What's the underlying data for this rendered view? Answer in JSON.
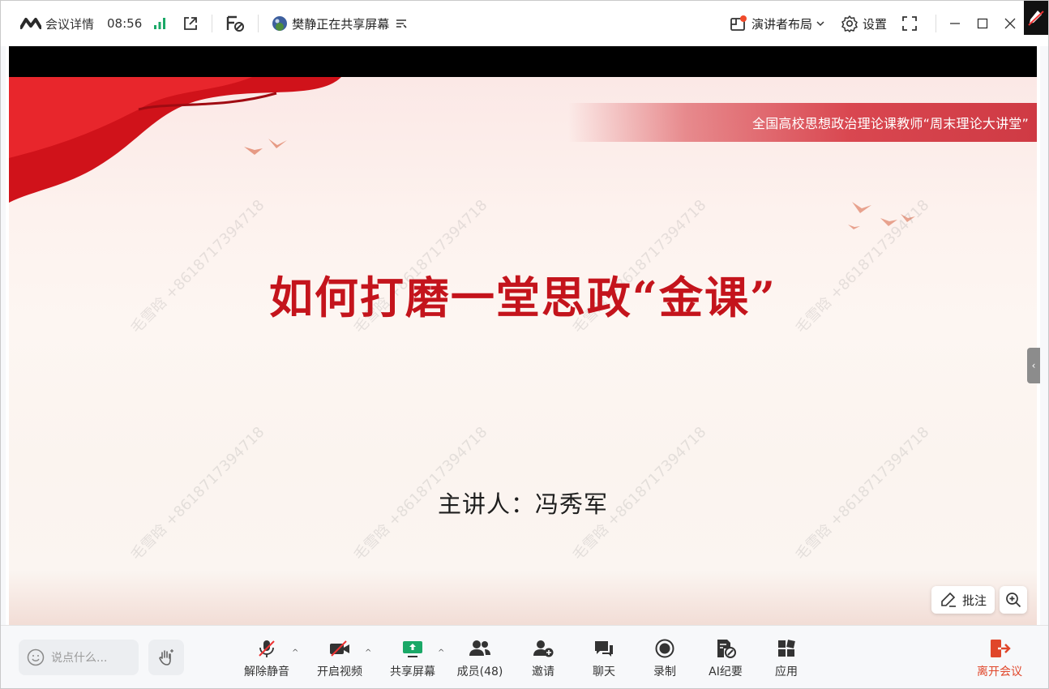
{
  "titlebar": {
    "meeting_details": "会议详情",
    "time": "08:56",
    "sharing_status": "樊静正在共享屏幕",
    "presenter_layout": "演讲者布局",
    "settings": "设置"
  },
  "slide": {
    "banner": "全国高校思想政治理论课教师“周末理论大讲堂”",
    "title": "如何打磨一堂思政“金课”",
    "presenter": "主讲人：冯秀军",
    "watermark": "毛雪晗 +8618717394718"
  },
  "share_controls": {
    "annotate": "批注"
  },
  "chat": {
    "placeholder": "说点什么..."
  },
  "toolbar": {
    "unmute": "解除静音",
    "start_video": "开启视频",
    "share_screen": "共享屏幕",
    "members": "成员(48)",
    "invite": "邀请",
    "chat": "聊天",
    "record": "录制",
    "ai_minutes": "AI纪要",
    "apps": "应用",
    "leave": "离开会议"
  },
  "colors": {
    "accent_green": "#1aa867",
    "leave_red": "#e0462a",
    "slide_title_red": "#c4141c",
    "banner_red": "#d94750"
  }
}
